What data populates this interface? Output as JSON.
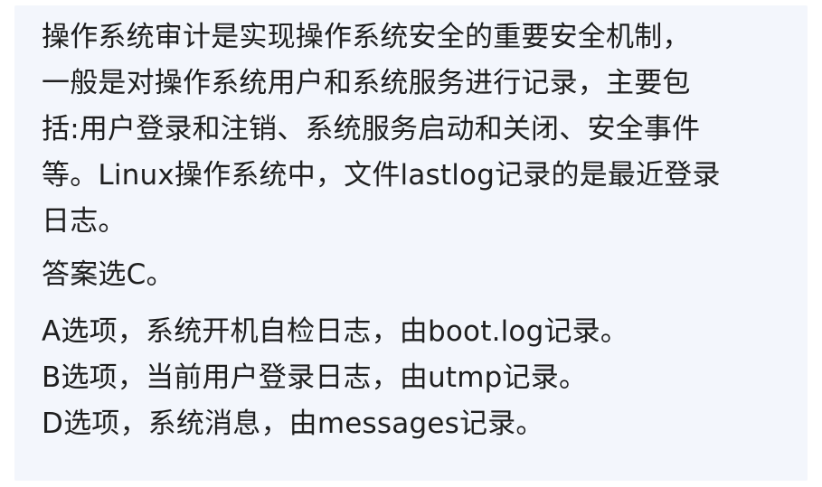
{
  "explanation": {
    "lines": [
      "操作系统审计是实现操作系统安全的重要安全机制，",
      "一般是对操作系统用户和系统服务进行记录，主要包",
      "括:用户登录和注销、系统服务启动和关闭、安全事件",
      "等。Linux操作系统中，文件lastlog记录的是最近登录",
      "日志。"
    ]
  },
  "answer": {
    "text": "答案选C。"
  },
  "options": [
    {
      "text": "A选项，系统开机自检日志，由boot.log记录。"
    },
    {
      "text": "B选项，当前用户登录日志，由utmp记录。"
    },
    {
      "text": "D选项，系统消息，由messages记录。"
    }
  ]
}
